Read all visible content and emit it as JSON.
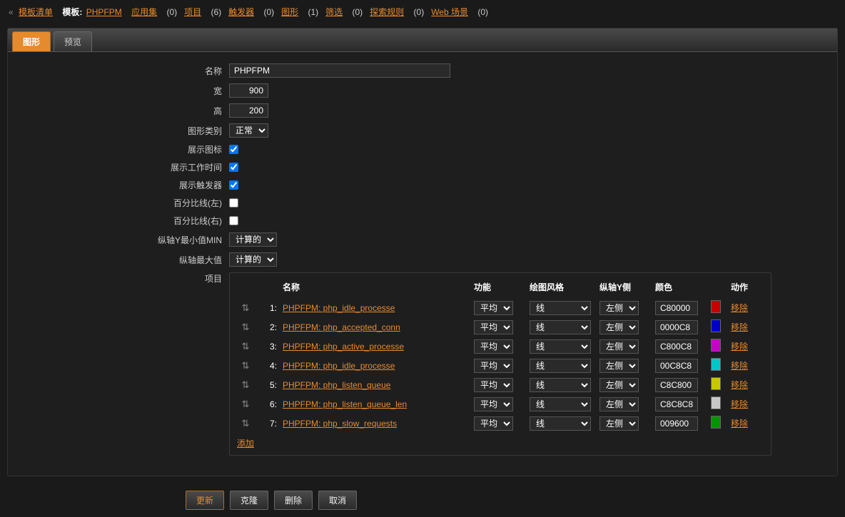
{
  "breadcrumb": {
    "list_link": "模板清单",
    "template_label": "模板:",
    "template_name": "PHPFPM",
    "links": [
      {
        "label": "应用集",
        "count": "(0)"
      },
      {
        "label": "项目",
        "count": "(6)"
      },
      {
        "label": "触发器",
        "count": "(0)"
      },
      {
        "label": "图形",
        "count": "(1)"
      },
      {
        "label": "筛选",
        "count": "(0)"
      },
      {
        "label": "探索规则",
        "count": "(0)"
      },
      {
        "label": "Web 场景",
        "count": "(0)"
      }
    ]
  },
  "tabs": {
    "graph": "图形",
    "preview": "预览"
  },
  "form": {
    "name_label": "名称",
    "name_value": "PHPFPM",
    "width_label": "宽",
    "width_value": "900",
    "height_label": "高",
    "height_value": "200",
    "type_label": "图形类别",
    "type_value": "正常",
    "legend_label": "展示图标",
    "worktime_label": "展示工作时间",
    "triggers_label": "展示触发器",
    "pctleft_label": "百分比线(左)",
    "pctright_label": "百分比线(右)",
    "ymin_label": "纵轴Y最小值MIN",
    "ymin_value": "计算的",
    "ymax_label": "纵轴最大值",
    "ymax_value": "计算的",
    "items_label": "项目"
  },
  "items_header": {
    "name": "名称",
    "func": "功能",
    "style": "绘图风格",
    "yaxis": "纵轴Y侧",
    "color": "颜色",
    "action": "动作"
  },
  "item_defaults": {
    "func": "平均",
    "style": "线",
    "side": "左侧",
    "remove": "移除"
  },
  "items": [
    {
      "n": "1:",
      "name": "PHPFPM: php_idle_processe",
      "color": "C80000",
      "hex": "#C80000"
    },
    {
      "n": "2:",
      "name": "PHPFPM: php_accepted_conn",
      "color": "0000C8",
      "hex": "#0000C8"
    },
    {
      "n": "3:",
      "name": "PHPFPM: php_active_processe",
      "color": "C800C8",
      "hex": "#C800C8"
    },
    {
      "n": "4:",
      "name": "PHPFPM: php_idle_processe",
      "color": "00C8C8",
      "hex": "#00C8C8"
    },
    {
      "n": "5:",
      "name": "PHPFPM: php_listen_queue",
      "color": "C8C800",
      "hex": "#C8C800"
    },
    {
      "n": "6:",
      "name": "PHPFPM: php_listen_queue_len",
      "color": "C8C8C8",
      "hex": "#C8C8C8"
    },
    {
      "n": "7:",
      "name": "PHPFPM: php_slow_requests",
      "color": "009600",
      "hex": "#009600"
    }
  ],
  "add_link": "添加",
  "buttons": {
    "update": "更新",
    "clone": "克隆",
    "delete": "删除",
    "cancel": "取消"
  }
}
